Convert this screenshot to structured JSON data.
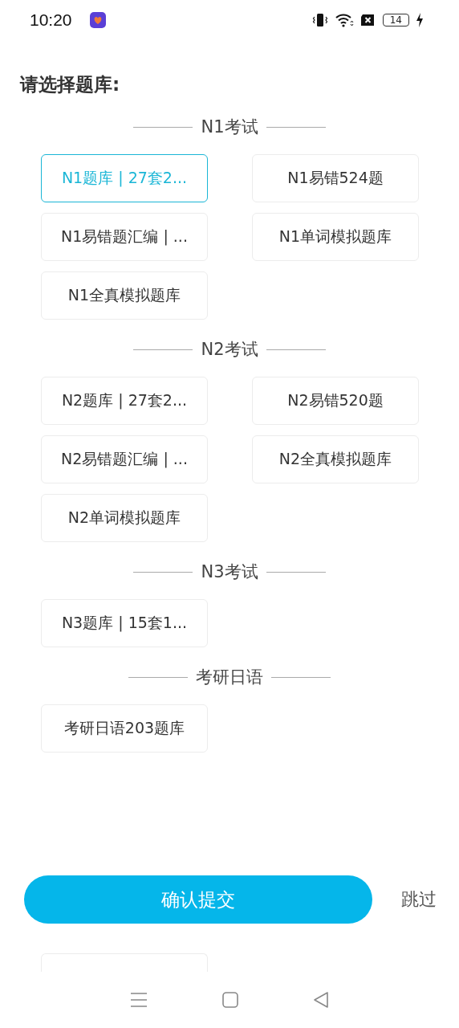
{
  "status_bar": {
    "time": "10:20",
    "battery": "14"
  },
  "title": "请选择题库:",
  "sections": [
    {
      "heading": "N1考试",
      "options": [
        {
          "label": "N1题库 | 27套2...",
          "selected": true
        },
        {
          "label": "N1易错524题",
          "selected": false
        },
        {
          "label": "N1易错题汇编 | ...",
          "selected": false
        },
        {
          "label": "N1单词模拟题库",
          "selected": false
        },
        {
          "label": "N1全真模拟题库",
          "selected": false
        }
      ]
    },
    {
      "heading": "N2考试",
      "options": [
        {
          "label": "N2题库 | 27套2...",
          "selected": false
        },
        {
          "label": "N2易错520题",
          "selected": false
        },
        {
          "label": "N2易错题汇编 | ...",
          "selected": false
        },
        {
          "label": "N2全真模拟题库",
          "selected": false
        },
        {
          "label": "N2单词模拟题库",
          "selected": false
        }
      ]
    },
    {
      "heading": "N3考试",
      "options": [
        {
          "label": "N3题库 | 15套1...",
          "selected": false
        }
      ]
    },
    {
      "heading": "考研日语",
      "options": [
        {
          "label": "考研日语203题库",
          "selected": false
        }
      ]
    }
  ],
  "submit_button": "确认提交",
  "skip_link": "跳过"
}
